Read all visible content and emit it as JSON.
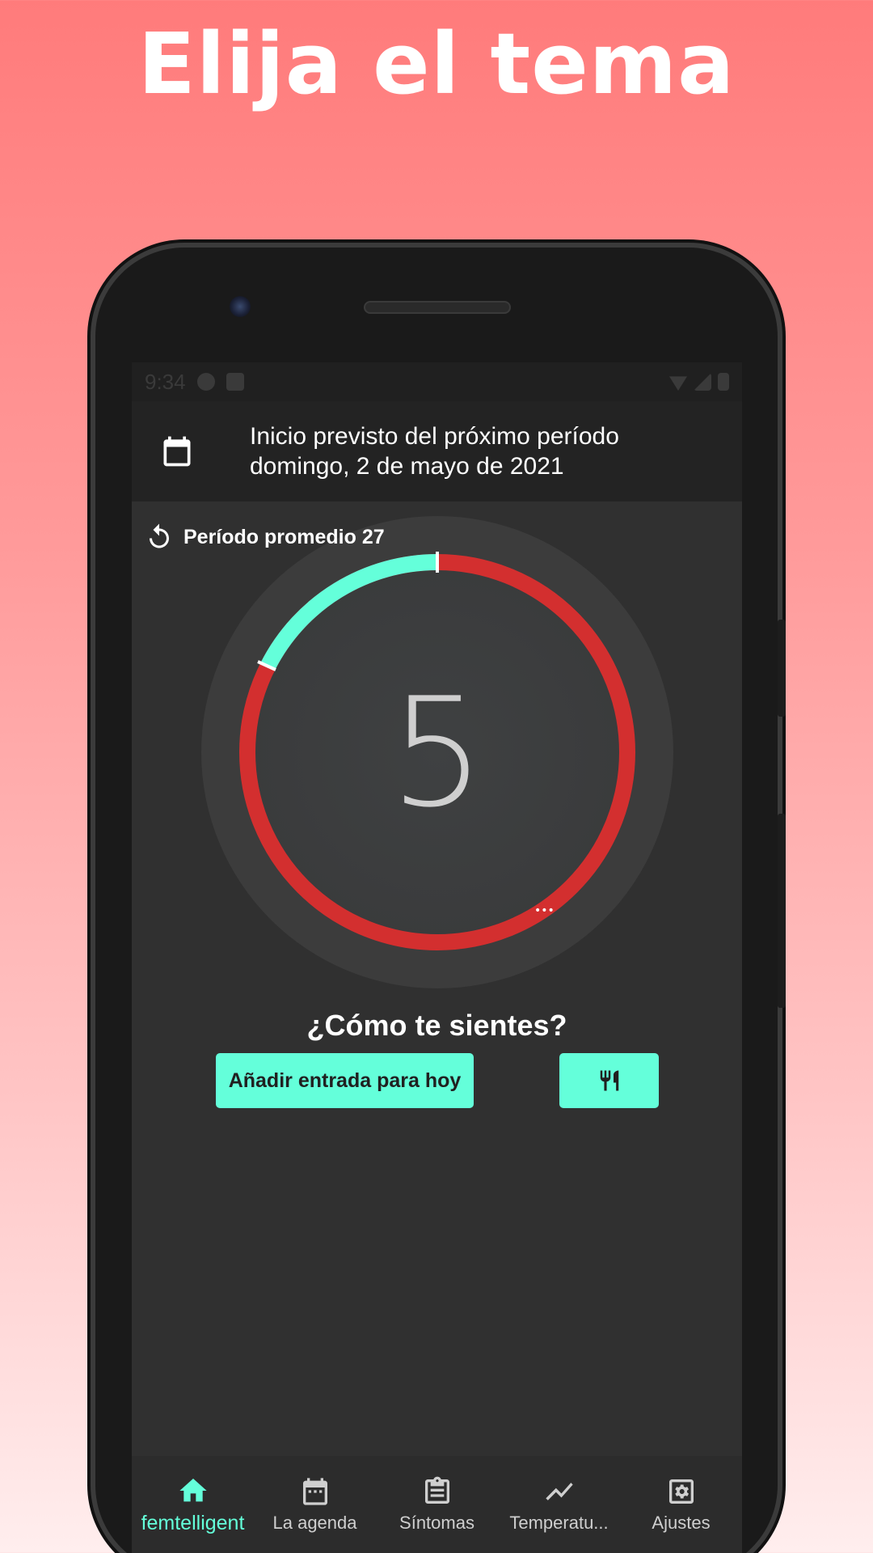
{
  "headline": "Elija el tema",
  "status_bar": {
    "time": "9:34"
  },
  "header": {
    "line1": "Inicio previsto del próximo período",
    "line2": "domingo, 2 de mayo de 2021"
  },
  "cycle": {
    "average_label": "Período promedio 27",
    "day": "5",
    "colors": {
      "period": "#d32f2f",
      "current": "#64ffda"
    }
  },
  "question": "¿Cómo te sientes?",
  "actions": {
    "add_entry_label": "Añadir entrada para hoy"
  },
  "accent_color": "#64ffda",
  "nav": {
    "items": [
      {
        "label": "femtelligent",
        "icon": "home-icon",
        "active": true
      },
      {
        "label": "La agenda",
        "icon": "calendar-icon"
      },
      {
        "label": "Síntomas",
        "icon": "clipboard-icon"
      },
      {
        "label": "Temperatu...",
        "icon": "trending-icon"
      },
      {
        "label": "Ajustes",
        "icon": "settings-icon"
      }
    ]
  }
}
